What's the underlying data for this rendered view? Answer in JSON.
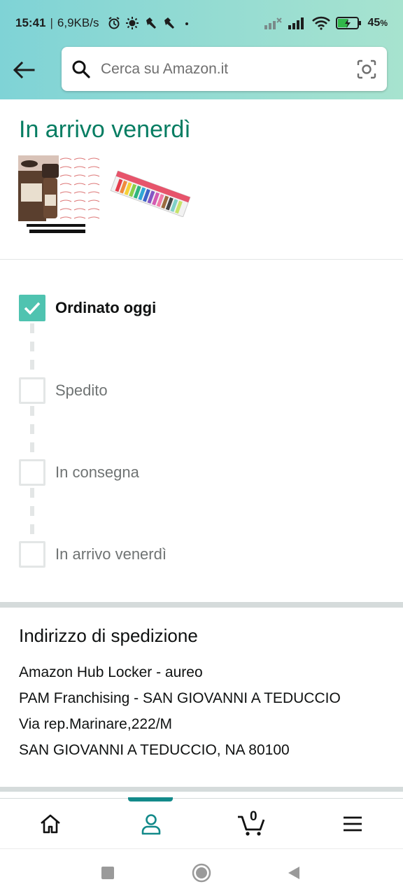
{
  "status_bar": {
    "time": "15:41",
    "speed": "6,9KB/s",
    "battery": "45",
    "battery_unit": "%"
  },
  "search": {
    "placeholder": "Cerca su Amazon.it"
  },
  "delivery": {
    "title": "In arrivo venerdì"
  },
  "tracker": {
    "steps": [
      {
        "label": "Ordinato oggi",
        "done": true
      },
      {
        "label": "Spedito",
        "done": false
      },
      {
        "label": "In consegna",
        "done": false
      },
      {
        "label": "In arrivo venerdì",
        "done": false
      }
    ]
  },
  "address": {
    "title": "Indirizzo di spedizione",
    "lines": [
      "Amazon Hub Locker - aureo",
      "PAM Franchising - SAN GIOVANNI A TEDUCCIO",
      "Via rep.Marinare,222/M",
      "SAN GIOVANNI A TEDUCCIO, NA 80100"
    ]
  },
  "nav": {
    "cart_count": "0",
    "items": [
      "home-icon",
      "account-icon",
      "cart-icon",
      "menu-icon"
    ]
  },
  "colors": {
    "accent_green": "#067d62",
    "check_teal": "#4fc3b0",
    "nav_indicator": "#138a8a"
  }
}
